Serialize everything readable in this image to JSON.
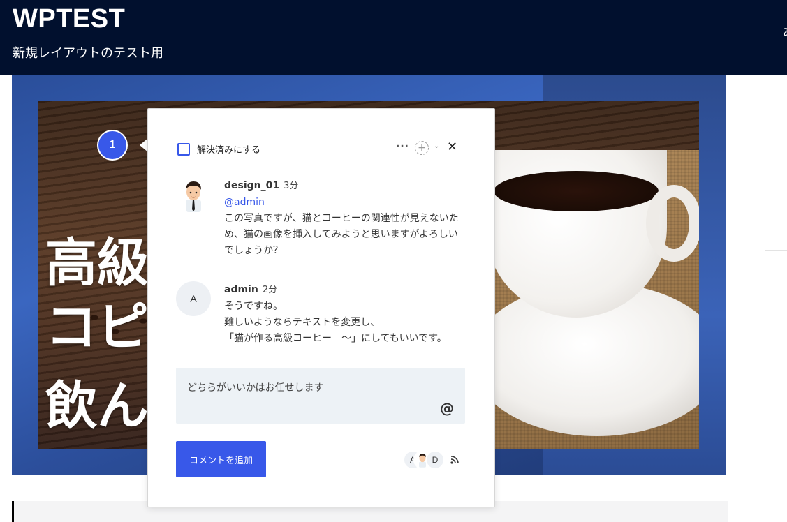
{
  "site": {
    "title": "WPTEST",
    "tagline": "新規レイアウトのテスト用",
    "edge_glyph": "あ"
  },
  "cover": {
    "headline_line1": "高級",
    "headline_line2": "コピ",
    "headline_line3": "飲ん"
  },
  "marker": {
    "number": "1"
  },
  "panel": {
    "resolve_label": "解決済みにする",
    "more_label": "···",
    "add_label": "+",
    "caret_label": "⌄",
    "close_label": "✕",
    "comments": [
      {
        "author": "design_01",
        "time": "3分",
        "mention": "@admin",
        "body": "この写真ですが、猫とコーヒーの関連性が見えないた\nめ、猫の画像を挿入してみようと思いますがよろしい\nでしょうか？",
        "avatar": "person-avatar"
      },
      {
        "author": "admin",
        "time": "2分",
        "avatar_letter": "A",
        "body": "そうですね。\n難しいようならテキストを変更し、\n「猫が作る高級コーヒー　～」にしてもいいです。"
      }
    ],
    "reply_text": "どちらがいいかはお任せします",
    "at_label": "@",
    "add_comment_label": "コメントを追加",
    "participants": [
      "A",
      "D"
    ]
  },
  "colors": {
    "header_bg": "#01102e",
    "accent": "#3858e9",
    "reply_bg": "#edf2f6"
  }
}
